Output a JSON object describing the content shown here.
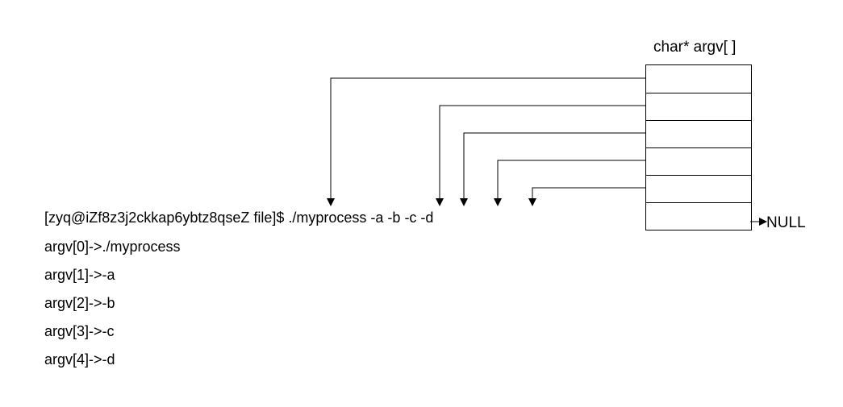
{
  "diagram": {
    "title": "char* argv[ ]",
    "null_label": "NULL",
    "command_line": "[zyq@iZf8z3j2ckkap6ybtz8qseZ file]$ ./myprocess -a -b -c -d",
    "argv_lines": [
      "argv[0]->./myprocess",
      "argv[1]->-a",
      "argv[2]->-b",
      "argv[3]->-c",
      "argv[4]->-d"
    ],
    "argv_cells": 6
  },
  "chart_data": {
    "type": "table",
    "title": "char* argv[ ]",
    "rows": [
      {
        "index": 0,
        "pointer_to": "./myprocess"
      },
      {
        "index": 1,
        "pointer_to": "-a"
      },
      {
        "index": 2,
        "pointer_to": "-b"
      },
      {
        "index": 3,
        "pointer_to": "-c"
      },
      {
        "index": 4,
        "pointer_to": "-d"
      },
      {
        "index": 5,
        "pointer_to": "NULL"
      }
    ],
    "command": "./myprocess -a -b -c -d",
    "prompt": "[zyq@iZf8z3j2ckkap6ybtz8qseZ file]$"
  }
}
